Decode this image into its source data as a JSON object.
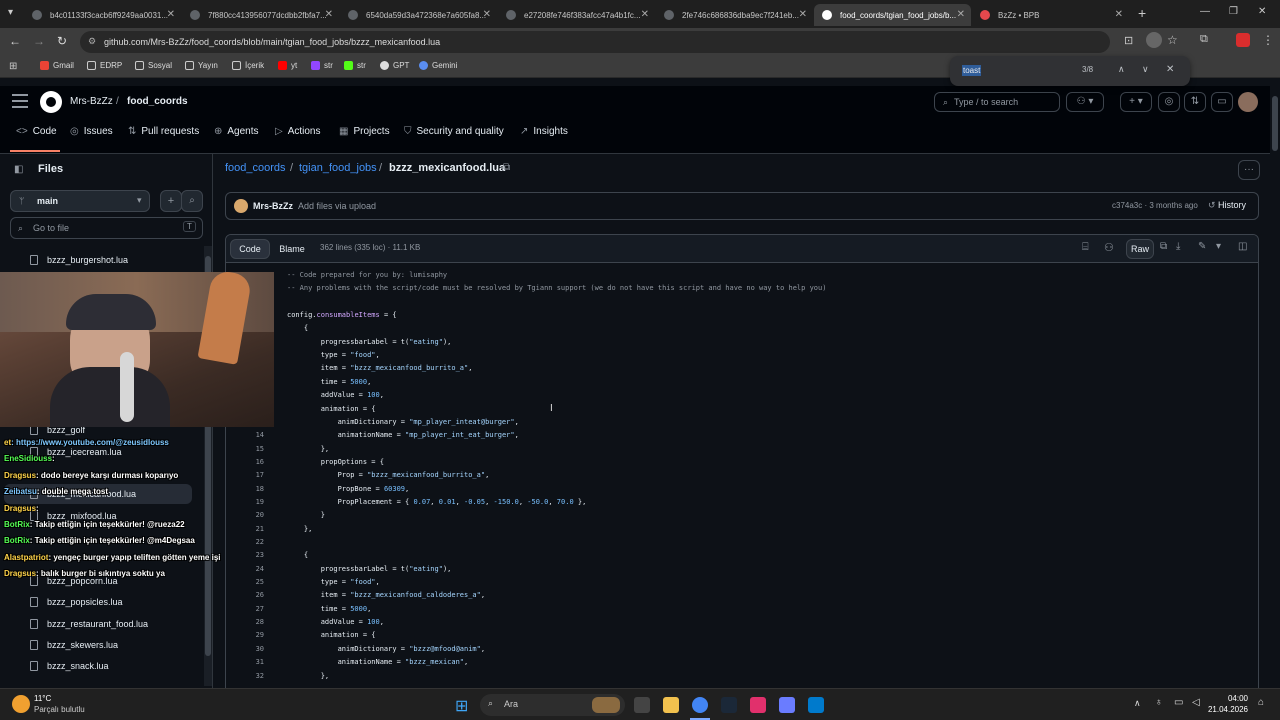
{
  "browser": {
    "tabs": [
      {
        "title": "b4c01133f3cacb6ff9249aa0031..."
      },
      {
        "title": "7f880cc413956077dcdbb2fbfa7..."
      },
      {
        "title": "6540da59d3a472368e7a605fa8..."
      },
      {
        "title": "e27208fe746f383afcc47a4b1fc..."
      },
      {
        "title": "2fe746c686836dba9ec7f241eb..."
      },
      {
        "title": "food_coords/tgian_food_jobs/b..."
      },
      {
        "title": "BzZz • BPB"
      }
    ],
    "new_tab": "+",
    "url": "github.com/Mrs-BzZz/food_coords/blob/main/tgian_food_jobs/bzzz_mexicanfood.lua",
    "bookmarks": [
      "Gmail",
      "EDRP",
      "Sosyal",
      "Yayın",
      "İçerik",
      "yt",
      "str",
      "str",
      "GPT",
      "Gemini"
    ],
    "find": {
      "query": "toast",
      "count": "3/8"
    }
  },
  "github": {
    "owner": "Mrs-BzZz",
    "repo": "food_coords",
    "nav": [
      "Code",
      "Issues",
      "Pull requests",
      "Agents",
      "Actions",
      "Projects",
      "Security and quality",
      "Insights"
    ],
    "search_placeholder": "Type / to search",
    "search_key": "/"
  },
  "sidebar": {
    "title": "Files",
    "branch": "main",
    "goto_placeholder": "Go to file",
    "goto_key": "T",
    "files": [
      "bzzz_burgershot.lua",
      "bzzz_golf",
      "bzzz_icecream.lua",
      "bzzz_mexicanfood.lua",
      "bzzz_mixfood.lua",
      "bzzz_popcorn.lua",
      "bzzz_popsicles.lua",
      "bzzz_restaurant_food.lua",
      "bzzz_skewers.lua",
      "bzzz_snack.lua"
    ]
  },
  "breadcrumb": {
    "root": "food_coords",
    "folder": "tgian_food_jobs",
    "file": "bzzz_mexicanfood.lua",
    "sep": "/"
  },
  "commit": {
    "author": "Mrs-BzZz",
    "message": "Add files via upload",
    "hash_time": "c374a3c · 3 months ago",
    "history": "History"
  },
  "file_toolbar": {
    "code_tab": "Code",
    "blame_tab": "Blame",
    "stats": "362 lines (335 loc) · 11.1 KB",
    "raw": "Raw"
  },
  "code": {
    "lines": [
      {
        "n": "1",
        "t": "-- Code prepared for you by: lumisaphy"
      },
      {
        "n": "2",
        "t": "-- Any problems with the script/code must be resolved by Tgiann support (we do not have this script and have no way to help you)"
      },
      {
        "n": "3",
        "t": ""
      },
      {
        "n": "4",
        "t": "config.consumableItems = {"
      },
      {
        "n": "5",
        "t": "    {"
      },
      {
        "n": "6",
        "t": "        progressbarLabel = t(\"eating\"),"
      },
      {
        "n": "7",
        "t": "        type = \"food\","
      },
      {
        "n": "8",
        "t": "        item = \"bzzz_mexicanfood_burrito_a\","
      },
      {
        "n": "9",
        "t": "        time = 5000,"
      },
      {
        "n": "10",
        "t": "        addValue = 100,"
      },
      {
        "n": "11",
        "t": "        animation = {"
      },
      {
        "n": "12",
        "t": "            animDictionary = \"mp_player_inteat@burger\","
      },
      {
        "n": "14",
        "t": "            animationName = \"mp_player_int_eat_burger\","
      },
      {
        "n": "15",
        "t": "        },"
      },
      {
        "n": "16",
        "t": "        propOptions = {"
      },
      {
        "n": "17",
        "t": "            Prop = \"bzzz_mexicanfood_burrito_a\","
      },
      {
        "n": "18",
        "t": "            PropBone = 60309,"
      },
      {
        "n": "19",
        "t": "            PropPlacement = { 0.07, 0.01, -0.05, -150.0, -50.0, 70.0 },"
      },
      {
        "n": "20",
        "t": "        }"
      },
      {
        "n": "21",
        "t": "    },"
      },
      {
        "n": "22",
        "t": ""
      },
      {
        "n": "23",
        "t": "    {"
      },
      {
        "n": "24",
        "t": "        progressbarLabel = t(\"eating\"),"
      },
      {
        "n": "25",
        "t": "        type = \"food\","
      },
      {
        "n": "26",
        "t": "        item = \"bzzz_mexicanfood_caldoderes_a\","
      },
      {
        "n": "27",
        "t": "        time = 5000,"
      },
      {
        "n": "28",
        "t": "        addValue = 100,"
      },
      {
        "n": "29",
        "t": "        animation = {"
      },
      {
        "n": "30",
        "t": "            animDictionary = \"bzzz@mfood@anim\","
      },
      {
        "n": "31",
        "t": "            animationName = \"bzzz_mexican\","
      },
      {
        "n": "32",
        "t": "        },"
      }
    ]
  },
  "stream_chat": [
    {
      "user": "et",
      "msg": ": https://www.youtube.com/@zeusidlouss"
    },
    {
      "user": "EneSidiouss",
      "msg": ":"
    },
    {
      "user": "Dragsus",
      "msg": ": dodo bereye karşı durması koparıyo"
    },
    {
      "user": "Zeibatsu",
      "msg": ": double mega tost"
    },
    {
      "user": "Dragsus",
      "msg": ":"
    },
    {
      "user": "BotRix",
      "msg": ": Takip ettiğin için teşekkürler! @rueza22"
    },
    {
      "user": "BotRix",
      "msg": ": Takip ettiğin için teşekkürler! @m4Degsaa"
    },
    {
      "user": "Alastpatriot",
      "msg": ": yengeç burger yapıp teliften götten yeme işi"
    },
    {
      "user": "Dragsus",
      "msg": ": balık burger bi sıkıntıya soktu ya"
    }
  ],
  "taskbar": {
    "weather_temp": "11°C",
    "weather_desc": "Parçalı bulutlu",
    "search": "Ara",
    "time": "04:00",
    "date": "21.04.2026"
  }
}
